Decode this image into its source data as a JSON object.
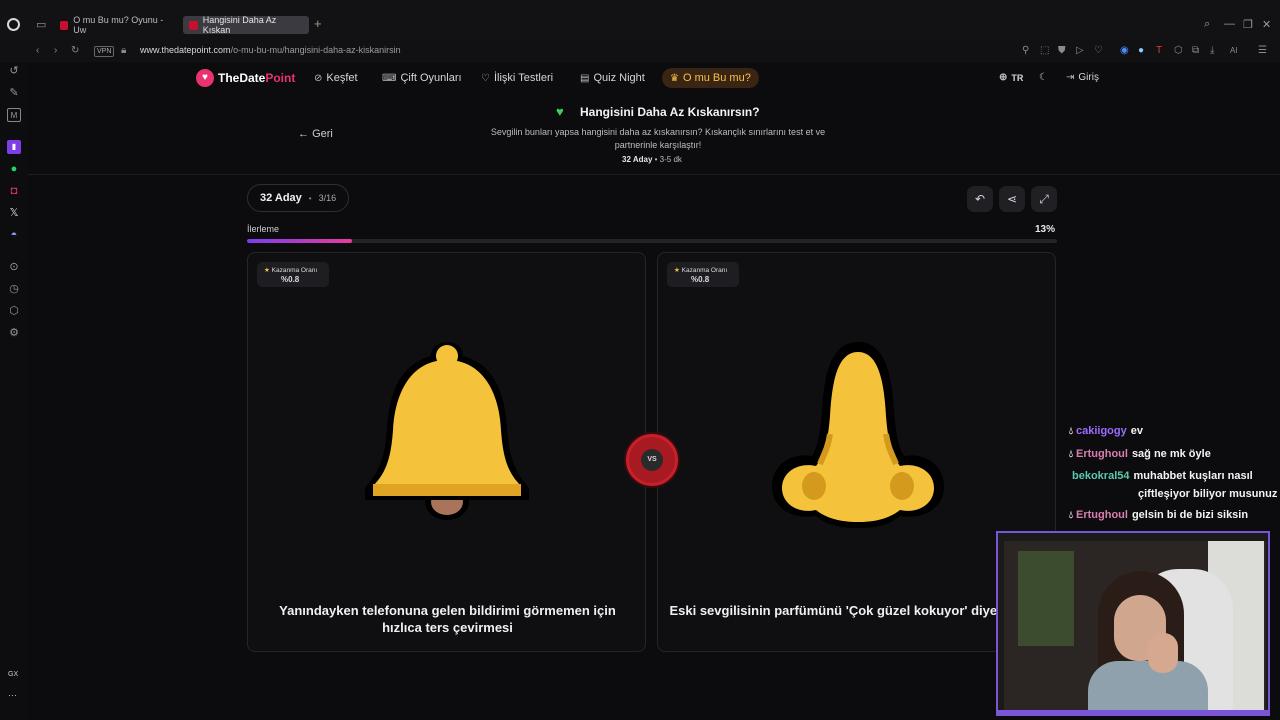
{
  "browser": {
    "tabs": [
      {
        "label": "O mu Bu mu? Oyunu - Uw"
      },
      {
        "label": "Hangisini Daha Az Kıskan"
      }
    ],
    "vpn_label": "VPN",
    "url_domain": "www.thedatepoint.com",
    "url_path": "/o-mu-bu-mu/hangisini-daha-az-kiskanirsin",
    "ai_label": "AI"
  },
  "sidebar": {
    "gx_label": "GX",
    "more_label": "···"
  },
  "nav": {
    "logo_the": "TheDate",
    "logo_point": "Point",
    "items": [
      {
        "label": "Keşfet"
      },
      {
        "label": "Çift Oyunları"
      },
      {
        "label": "İlişki Testleri"
      },
      {
        "label": "Quiz Night"
      },
      {
        "label": "O mu Bu mu?"
      }
    ],
    "lang": "TR",
    "login": "Giriş"
  },
  "header": {
    "back_label": "Geri",
    "title": "Hangisini Daha Az Kıskanırsın?",
    "description": "Sevgilin bunları yapsa hangisini daha az kıskanırsın? Kıskançlık sınırlarını test et ve partnerinle karşılaştır!",
    "candidates": "32 Aday",
    "duration": "3-5 dk"
  },
  "game": {
    "candidates": "32 Aday",
    "round": "3/16",
    "progress_label": "İlerleme",
    "progress_text": "13%",
    "progress_value": 13,
    "vs_label": "VS",
    "cards": [
      {
        "badge_label": "Kazanma Oranı",
        "badge_value": "%0.8",
        "emoji": "bell-icon",
        "caption": "Yanındayken telefonuna gelen bildirimi görmemen için hızlıca ters çevirmesi"
      },
      {
        "badge_label": "Kazanma Oranı",
        "badge_value": "%0.8",
        "emoji": "nose-icon",
        "caption": "Eski sevgilisinin parfümünü 'Çok güzel kokuyor' diye övmesi"
      }
    ]
  },
  "chat": [
    {
      "user": "cakiigogy",
      "user_color": "#9b6cff",
      "message": "ev",
      "badge": true
    },
    {
      "user": "Ertughoul",
      "user_color": "#d87fb0",
      "message": "sağ ne mk öyle",
      "badge": true
    },
    {
      "user": "bekokral54",
      "user_color": "#5cc8b0",
      "message": "muhabbet kuşları nasıl",
      "message2": "çiftleşiyor biliyor musunuz",
      "badge": false
    },
    {
      "user": "Ertughoul",
      "user_color": "#d87fb0",
      "message": "gelsin bi de bizi siksin",
      "badge": true
    }
  ],
  "colors": {
    "accent_pink": "#e8336f",
    "accent_gold": "#f6c244",
    "bell_yellow": "#f5c33b",
    "vs_red": "#c8202b"
  }
}
